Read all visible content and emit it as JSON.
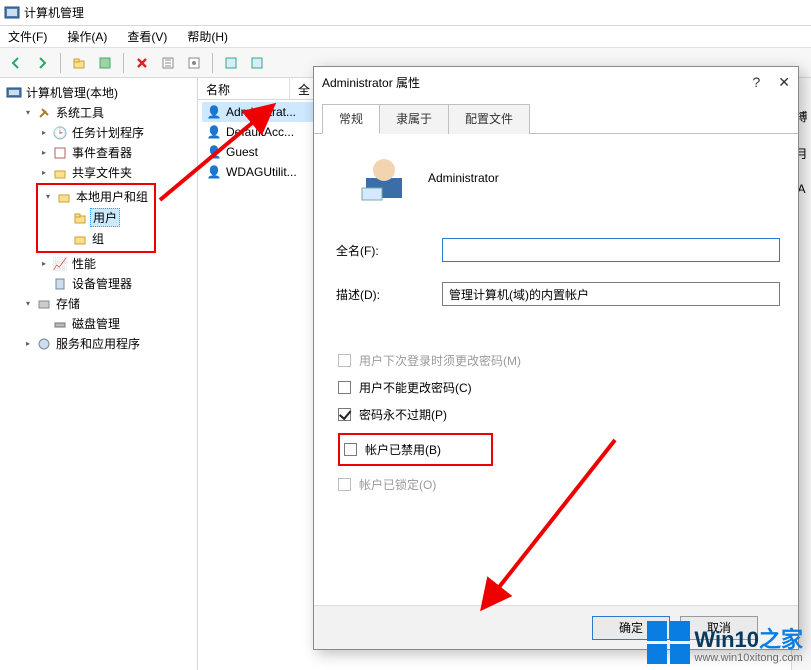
{
  "window": {
    "title": "计算机管理"
  },
  "menu": {
    "file": "文件(F)",
    "action": "操作(A)",
    "view": "查看(V)",
    "help": "帮助(H)"
  },
  "toolbar_icons": [
    "back-icon",
    "forward-icon",
    "up-icon",
    "show-icon",
    "delete-icon",
    "refresh-icon",
    "properties-icon",
    "help-icon",
    "list-icon",
    "details-icon"
  ],
  "tree": {
    "root": "计算机管理(本地)",
    "system_tools": "系统工具",
    "task_scheduler": "任务计划程序",
    "event_viewer": "事件查看器",
    "shared_folders": "共享文件夹",
    "local_users": "本地用户和组",
    "users": "用户",
    "groups": "组",
    "performance": "性能",
    "device_manager": "设备管理器",
    "storage": "存储",
    "disk_management": "磁盘管理",
    "services_apps": "服务和应用程序"
  },
  "list": {
    "header_name": "名称",
    "header_full": "全",
    "rows": [
      "Administrat...",
      "DefaultAcc...",
      "Guest",
      "WDAGUtilit..."
    ]
  },
  "right": {
    "a": "搏",
    "b": "月",
    "c": "A"
  },
  "dialog": {
    "title": "Administrator 属性",
    "help": "?",
    "close": "✕",
    "tabs": {
      "general": "常规",
      "member": "隶属于",
      "profile": "配置文件"
    },
    "user_name": "Administrator",
    "fullname_label": "全名(F):",
    "fullname_value": "",
    "desc_label": "描述(D):",
    "desc_value": "管理计算机(域)的内置帐户",
    "chk_nextlogon": "用户下次登录时须更改密码(M)",
    "chk_cannot": "用户不能更改密码(C)",
    "chk_never": "密码永不过期(P)",
    "chk_disabled": "帐户已禁用(B)",
    "chk_locked": "帐户已锁定(O)",
    "ok": "确定",
    "cancel": "取消"
  },
  "watermark": {
    "brand_a": "Win10",
    "brand_b": "之家",
    "url": "www.win10xitong.com"
  }
}
